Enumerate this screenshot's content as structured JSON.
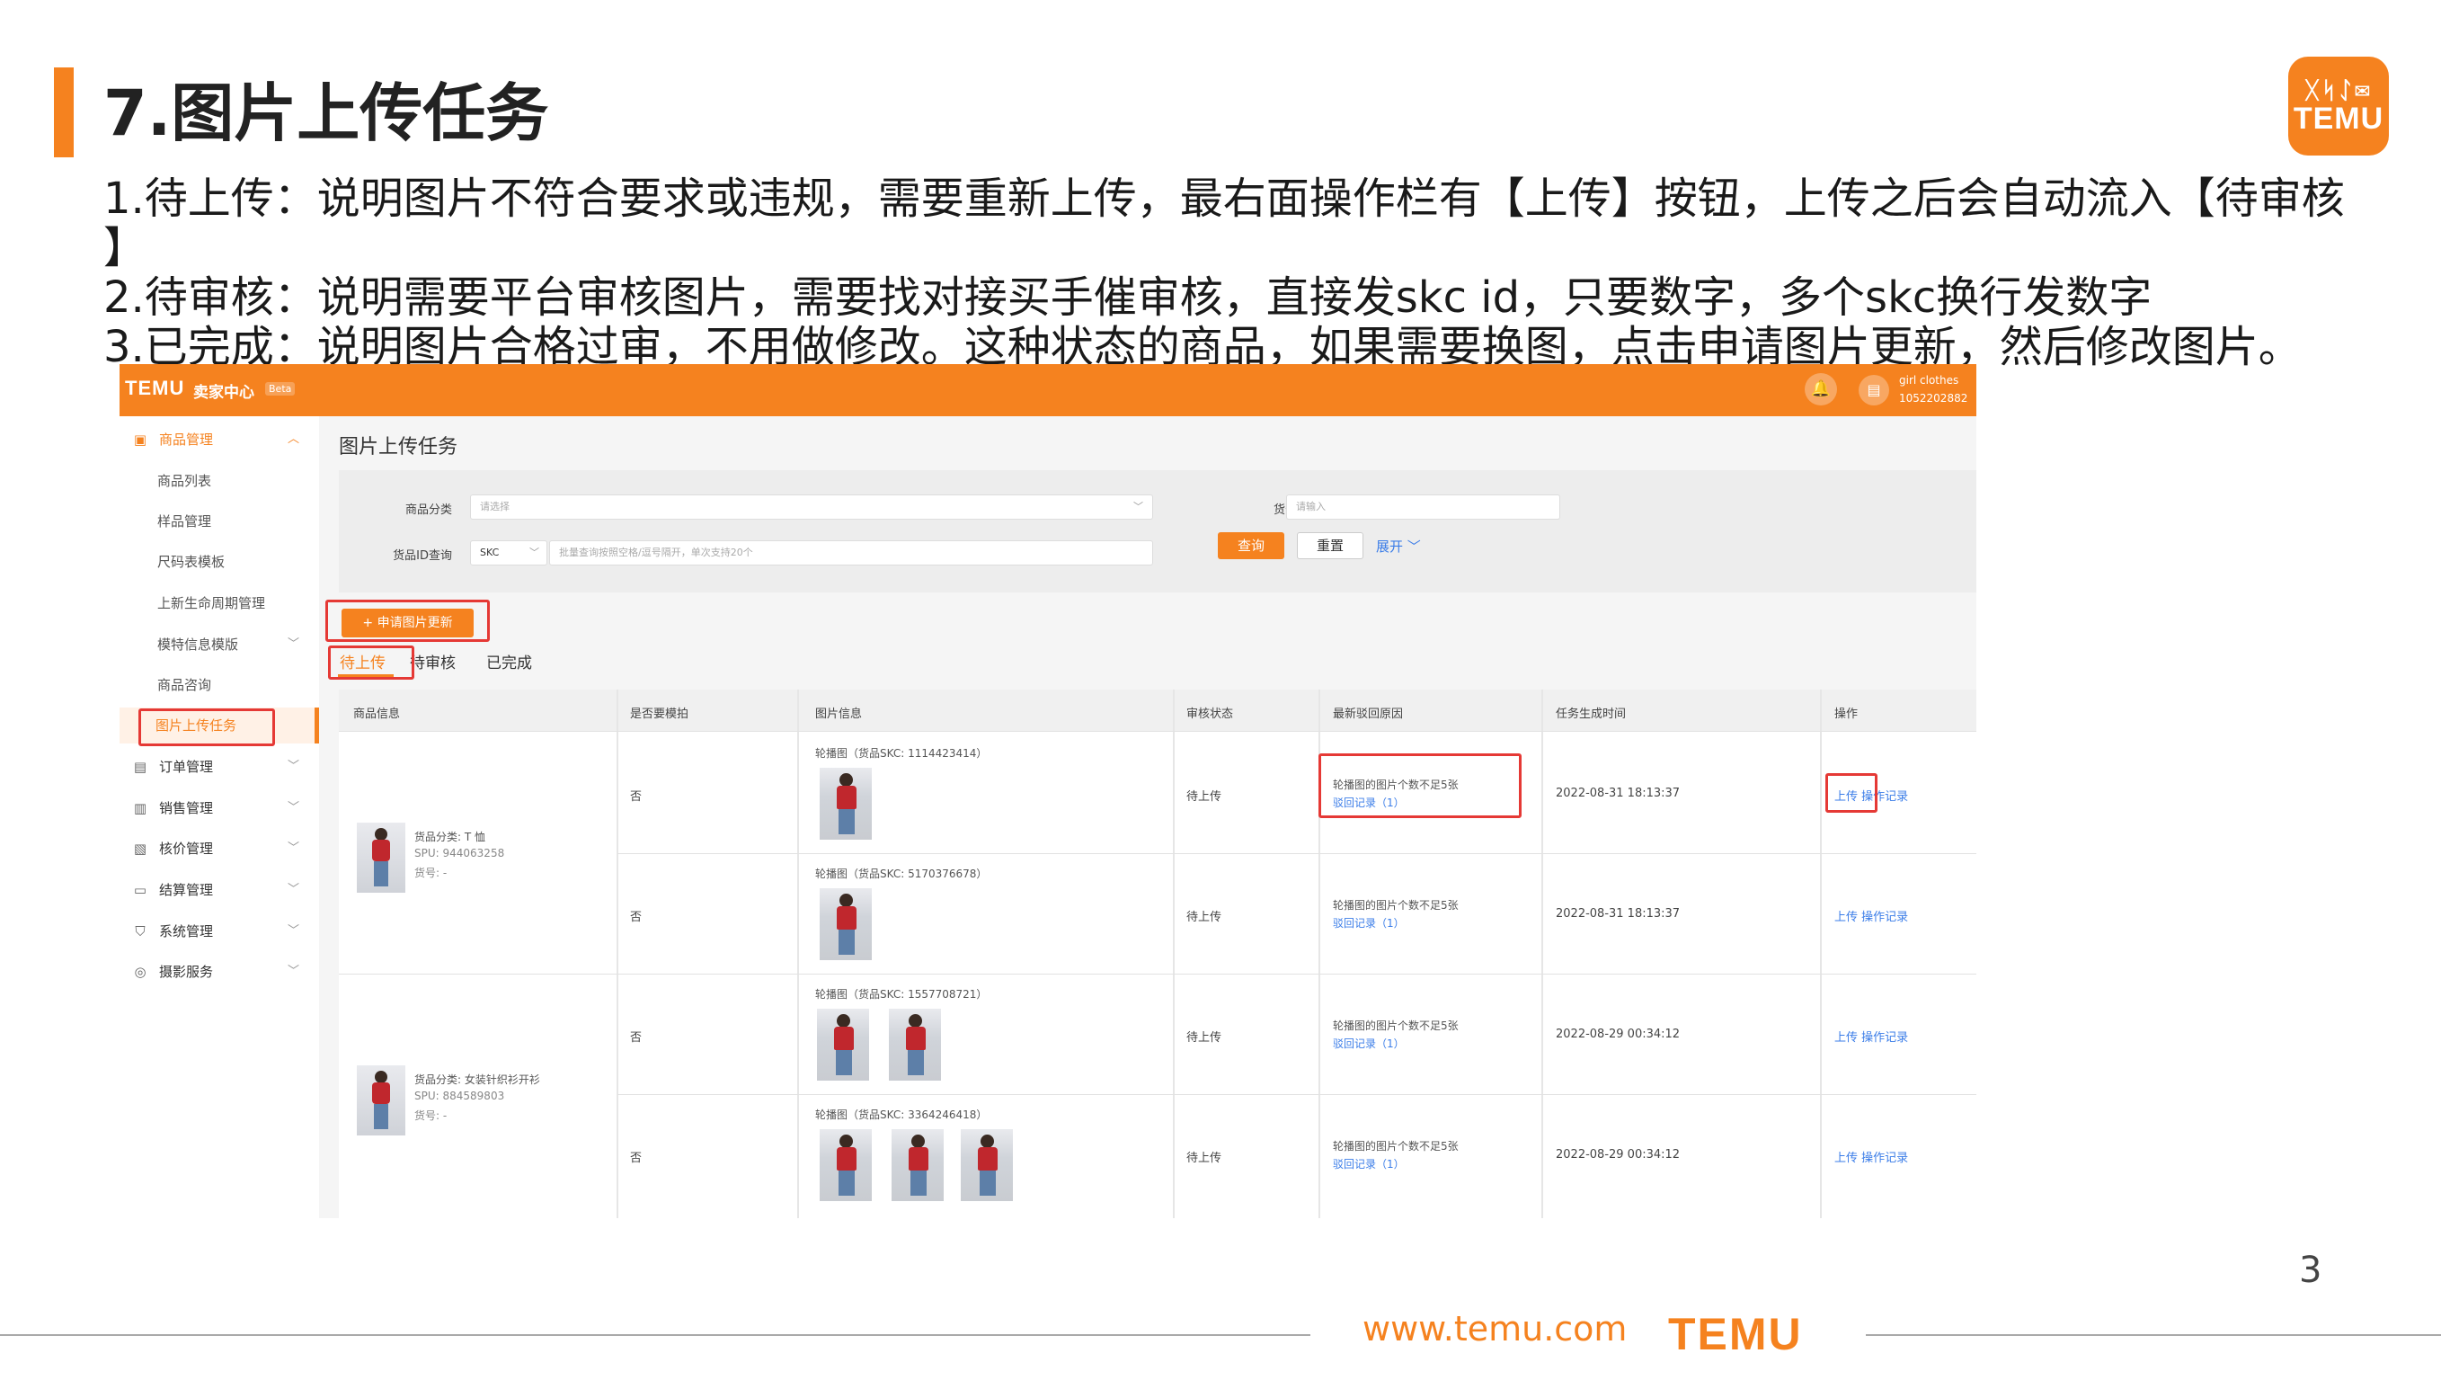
{
  "slide": {
    "title": "7.图片上传任务",
    "desc_line1": "1.待上传：说明图片不符合要求或违规，需要重新上传，最右面操作栏有【上传】按钮，上传之后会自动流入【待审核",
    "desc_line1_cont": "】",
    "desc_line2": "2.待审核：说明需要平台审核图片，需要找对接买手催审核，直接发skc id，只要数字，多个skc换行发数字",
    "desc_line3": "3.已完成：说明图片合格过审，不用做修改。这种状态的商品，如果需要换图，点击申请图片更新，然后修改图片。",
    "page_number": "3",
    "footer_url": "www.temu.com",
    "footer_logo": "TEMU",
    "logo_symbols": "ᚷᛋᛇ✉",
    "logo_text": "TEMU"
  },
  "app": {
    "brand": "TEMU",
    "center_name": "卖家中心",
    "beta": "Beta",
    "user_name": "girl clothes",
    "user_id": "1052202882"
  },
  "sidebar": {
    "items": [
      {
        "label": "商品管理",
        "icon": "product-icon"
      },
      {
        "label": "商品列表"
      },
      {
        "label": "样品管理"
      },
      {
        "label": "尺码表模板"
      },
      {
        "label": "上新生命周期管理"
      },
      {
        "label": "模特信息模版"
      },
      {
        "label": "商品咨询"
      },
      {
        "label": "图片上传任务"
      },
      {
        "label": "订单管理",
        "icon": "order-icon"
      },
      {
        "label": "销售管理",
        "icon": "sales-icon"
      },
      {
        "label": "核价管理",
        "icon": "pricing-icon"
      },
      {
        "label": "结算管理",
        "icon": "settlement-icon"
      },
      {
        "label": "系统管理",
        "icon": "system-icon"
      },
      {
        "label": "摄影服务",
        "icon": "camera-icon"
      }
    ]
  },
  "main": {
    "title": "图片上传任务",
    "filter": {
      "category_label": "商品分类",
      "category_placeholder": "请选择",
      "item_no_label": "货号",
      "item_no_placeholder": "请输入",
      "id_query_label": "货品ID查询",
      "id_type": "SKC",
      "id_placeholder": "批量查询按照空格/逗号隔开，单次支持20个",
      "query_button": "查询",
      "reset_button": "重置",
      "expand_button": "展开"
    },
    "apply_button": "+ 申请图片更新",
    "tabs": [
      "待上传",
      "待审核",
      "已完成"
    ],
    "table": {
      "headers": [
        "商品信息",
        "是否要模拍",
        "图片信息",
        "审核状态",
        "最新驳回原因",
        "任务生成时间",
        "操作"
      ],
      "spus": [
        {
          "category": "货品分类: T 恤",
          "spu": "SPU: 944063258",
          "item_no": "货号: -"
        },
        {
          "category": "货品分类: 女装针织衫开衫",
          "spu": "SPU: 884589803",
          "item_no": "货号: -"
        }
      ],
      "rows": [
        {
          "model_shoot": "否",
          "image_info": "轮播图（货品SKC: 1114423414）",
          "image_count": 1,
          "status": "待上传",
          "reason": "轮播图的图片个数不足5张",
          "reject_link": "驳回记录（1）",
          "time": "2022-08-31 18:13:37",
          "op_upload": "上传",
          "op_log": "操作记录"
        },
        {
          "model_shoot": "否",
          "image_info": "轮播图（货品SKC: 5170376678）",
          "image_count": 1,
          "status": "待上传",
          "reason": "轮播图的图片个数不足5张",
          "reject_link": "驳回记录（1）",
          "time": "2022-08-31 18:13:37",
          "op_upload": "上传",
          "op_log": "操作记录"
        },
        {
          "model_shoot": "否",
          "image_info": "轮播图（货品SKC: 1557708721）",
          "image_count": 2,
          "status": "待上传",
          "reason": "轮播图的图片个数不足5张",
          "reject_link": "驳回记录（1）",
          "time": "2022-08-29 00:34:12",
          "op_upload": "上传",
          "op_log": "操作记录"
        },
        {
          "model_shoot": "否",
          "image_info": "轮播图（货品SKC: 3364246418）",
          "image_count": 3,
          "status": "待上传",
          "reason": "轮播图的图片个数不足5张",
          "reject_link": "驳回记录（1）",
          "time": "2022-08-29 00:34:12",
          "op_upload": "上传",
          "op_log": "操作记录"
        }
      ]
    }
  },
  "colors": {
    "accent": "#f5821f",
    "highlight": "#e53935",
    "link": "#3b7de8"
  }
}
